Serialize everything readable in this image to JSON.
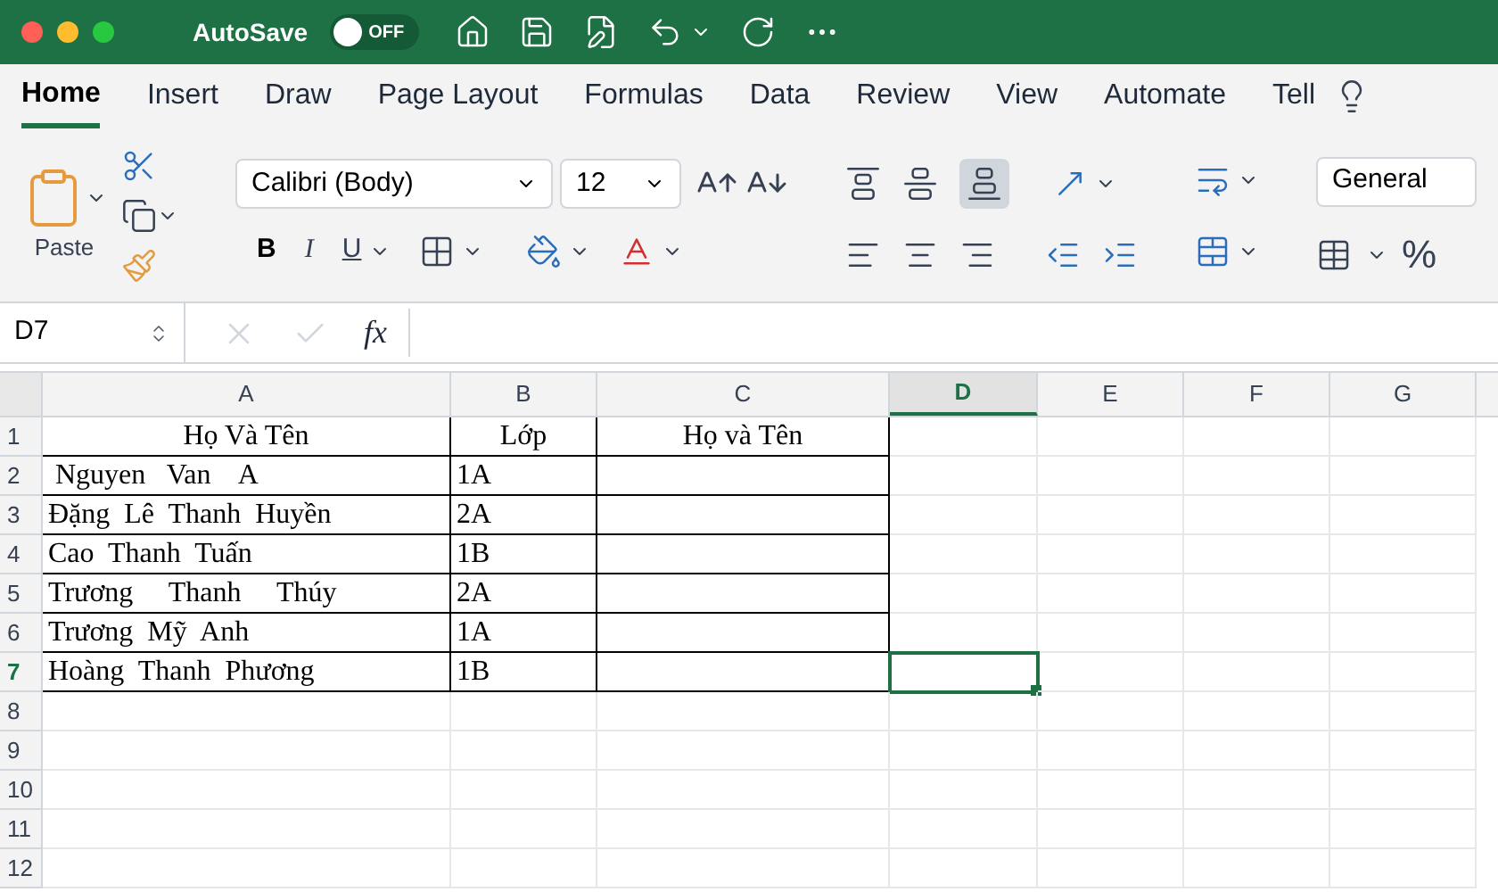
{
  "title_bar": {
    "autosave_label": "AutoSave",
    "autosave": {
      "on": false,
      "label": "OFF"
    }
  },
  "tabs": [
    {
      "label": "Home",
      "selected": true
    },
    {
      "label": "Insert",
      "selected": false
    },
    {
      "label": "Draw",
      "selected": false
    },
    {
      "label": "Page Layout",
      "selected": false
    },
    {
      "label": "Formulas",
      "selected": false
    },
    {
      "label": "Data",
      "selected": false
    },
    {
      "label": "Review",
      "selected": false
    },
    {
      "label": "View",
      "selected": false
    },
    {
      "label": "Automate",
      "selected": false
    },
    {
      "label": "Tell",
      "selected": false
    }
  ],
  "ribbon": {
    "paste_label": "Paste",
    "font_name": "Calibri (Body)",
    "font_size": "12",
    "bold": "B",
    "italic": "I",
    "underline": "U",
    "number_format": "General",
    "percent": "%"
  },
  "formula_bar": {
    "name_box": "D7",
    "fx": "fx"
  },
  "sheet": {
    "columns": [
      {
        "label": "A",
        "selected": false
      },
      {
        "label": "B",
        "selected": false
      },
      {
        "label": "C",
        "selected": false
      },
      {
        "label": "D",
        "selected": true
      },
      {
        "label": "E",
        "selected": false
      },
      {
        "label": "F",
        "selected": false
      },
      {
        "label": "G",
        "selected": false
      }
    ],
    "rows": [
      {
        "number": "1",
        "selected": false,
        "kind": "header",
        "cells": [
          "Họ Và Tên",
          "Lớp",
          "Họ và Tên"
        ]
      },
      {
        "number": "2",
        "selected": false,
        "kind": "data",
        "cells": [
          " Nguyen   Van    A",
          "1A"
        ]
      },
      {
        "number": "3",
        "selected": false,
        "kind": "data",
        "cells": [
          "Đặng  Lê  Thanh  Huyền",
          "2A"
        ]
      },
      {
        "number": "4",
        "selected": false,
        "kind": "data",
        "cells": [
          "Cao  Thanh  Tuấn",
          "1B"
        ]
      },
      {
        "number": "5",
        "selected": false,
        "kind": "data",
        "cells": [
          "Trương     Thanh     Thúy",
          "2A"
        ]
      },
      {
        "number": "6",
        "selected": false,
        "kind": "data",
        "cells": [
          "Trương  Mỹ  Anh",
          "1A"
        ]
      },
      {
        "number": "7",
        "selected": true,
        "kind": "data",
        "cells": [
          "Hoàng  Thanh  Phương",
          "1B"
        ]
      },
      {
        "number": "8",
        "selected": false,
        "kind": "empty"
      },
      {
        "number": "9",
        "selected": false,
        "kind": "empty"
      },
      {
        "number": "10",
        "selected": false,
        "kind": "empty"
      },
      {
        "number": "11",
        "selected": false,
        "kind": "empty"
      },
      {
        "number": "12",
        "selected": false,
        "kind": "empty"
      }
    ]
  }
}
